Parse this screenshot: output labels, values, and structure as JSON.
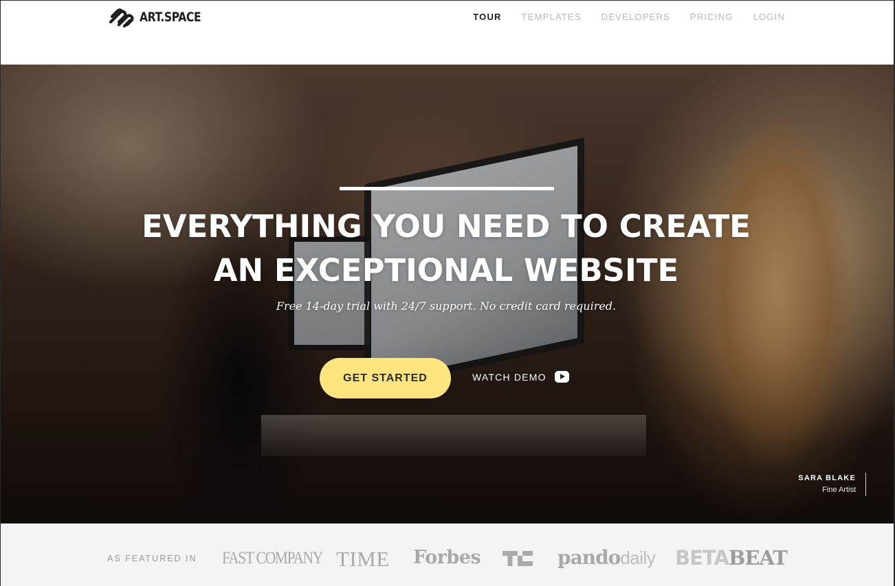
{
  "header": {
    "brand": "ART.SPACE",
    "nav": [
      {
        "label": "TOUR",
        "active": true
      },
      {
        "label": "TEMPLATES",
        "active": false
      },
      {
        "label": "DEVELOPERS",
        "active": false
      },
      {
        "label": "PRICING",
        "active": false
      },
      {
        "label": "LOGIN",
        "active": false
      }
    ]
  },
  "hero": {
    "title_line1": "EVERYTHING YOU NEED TO CREATE",
    "title_line2": "AN EXCEPTIONAL WEBSITE",
    "subtitle": "Free 14-day trial with 24/7 support. No credit card required.",
    "primary_cta": "GET STARTED",
    "secondary_cta": "WATCH DEMO",
    "secondary_cta_icon": "play-icon",
    "photo_credit": {
      "name": "SARA BLAKE",
      "role": "Fine Artist"
    }
  },
  "featured": {
    "label": "AS FEATURED IN",
    "press": {
      "fastcompany": "FAST COMPANY",
      "time": "TIME",
      "forbes": "Forbes",
      "techcrunch": "TC",
      "pando_bold": "pando",
      "pando_thin": "daily",
      "betabeat_a": "BETA",
      "betabeat_b": "BEAT"
    }
  },
  "colors": {
    "accent_button": "#ffe57f",
    "nav_active": "#1e1e1e",
    "nav_inactive": "#b9b9b9",
    "featured_bg": "#f4f4f4"
  }
}
